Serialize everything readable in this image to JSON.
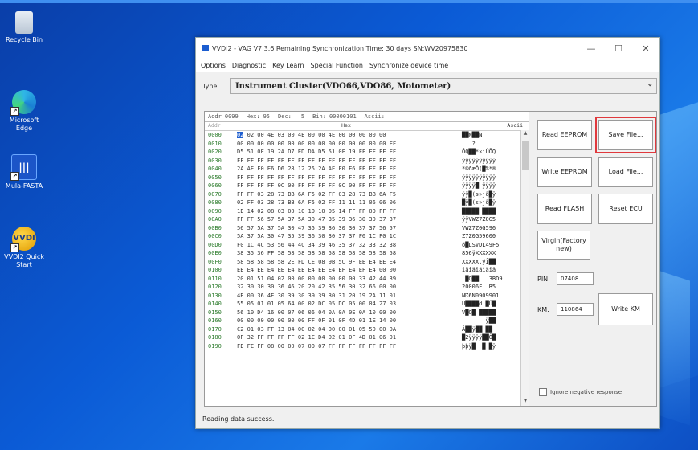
{
  "desktop": {
    "icons": [
      {
        "label": "Recycle Bin"
      },
      {
        "label": "Microsoft Edge"
      },
      {
        "label": "Mula-FASTA"
      },
      {
        "label": "VVDI2 Quick Start"
      }
    ]
  },
  "window": {
    "title": "VVDI2 - VAG V7.3.6    Remaining Synchronization Time: 30 days    SN:WV20975830",
    "menu": [
      "Options",
      "Diagnostic",
      "Key Learn",
      "Special Function",
      "Synchronize device time"
    ],
    "type_label": "Type",
    "type_value": "Instrument Cluster(VDO66,VDO86, Motometer)",
    "hex_header": {
      "addr_label": "Addr",
      "addr_value": "0099",
      "hex_label": "Hex:",
      "hex_value": "95",
      "dec_label": "Dec:",
      "dec_value": "5",
      "bin_label": "Bin:",
      "bin_value": "00000101",
      "ascii_label": "Ascii:"
    },
    "hex_columns": {
      "addr": "Addr",
      "hex": "Hex",
      "ascii": "Ascii"
    },
    "hex_rows": [
      {
        "addr": "0000",
        "sel": "02",
        "hex": " 02 00 4E 03 00 4E 00 00 4E 00 00 00 00 00",
        "ascii": "██N██N"
      },
      {
        "addr": "0010",
        "hex": "00 00 00 00 00 00 00 00 00 00 00 00 00 00 00 FF",
        "ascii": "   ?"
      },
      {
        "addr": "0020",
        "hex": "D5 51 0F 19 2A D7 ED DA D5 51 0F 19 FF FF FF FF",
        "ascii": "ÕQ██*×íÚÕQ"
      },
      {
        "addr": "0030",
        "hex": "FF FF FF FF FF FF FF FF FF FF FF FF FF FF FF FF",
        "ascii": "ÿÿÿÿÿÿÿÿÿÿ"
      },
      {
        "addr": "0040",
        "hex": "2A AE F0 E6 D6 28 12 25 2A AE F0 E6 FF FF FF FF",
        "ascii": "*®ðæÖ(█%*®"
      },
      {
        "addr": "0050",
        "hex": "FF FF FF FF FF FF FF FF FF FF FF FF FF FF FF FF",
        "ascii": "ÿÿÿÿÿÿÿÿÿÿ"
      },
      {
        "addr": "0060",
        "hex": "FF FF FF FF 0C 00 FF FF FF FF 0C 00 FF FF FF FF",
        "ascii": "ÿÿÿÿ█ ÿÿÿÿ"
      },
      {
        "addr": "0070",
        "hex": "FF FF 03 28 73 BB 6A F5 02 FF 03 28 73 BB 6A F5",
        "ascii": "ÿÿ█(s»jõ█ÿ"
      },
      {
        "addr": "0080",
        "hex": "02 FF 03 28 73 BB 6A F5 02 FF 11 11 11 06 06 06",
        "ascii": "█ÿ█(s»jõ█ÿ"
      },
      {
        "addr": "0090",
        "hex": "1E 14 02 08 03 00 10 10 10 05 14 FF FF 00 FF FF",
        "ascii": "█████ ████"
      },
      {
        "addr": "00A0",
        "hex": "FF FF 56 57 5A 37 5A 30 47 35 39 36 30 30 37 37",
        "ascii": "ÿÿVWZ7Z0G5"
      },
      {
        "addr": "00B0",
        "hex": "56 57 5A 37 5A 30 47 35 39 36 30 30 37 37 56 57",
        "ascii": "VWZ7Z0G596"
      },
      {
        "addr": "00C0",
        "hex": "5A 37 5A 30 47 35 39 36 30 30 37 37 F0 1C F0 1C",
        "ascii": "Z7Z0G59600"
      },
      {
        "addr": "00D0",
        "hex": "F0 1C 4C 53 56 44 4C 34 39 46 35 37 32 33 32 38",
        "ascii": "ð█LSVDL49F5"
      },
      {
        "addr": "00E0",
        "hex": "38 35 36 FF 58 58 58 58 58 58 58 58 58 58 58 58",
        "ascii": "856ÿXXXXXX"
      },
      {
        "addr": "00F0",
        "hex": "58 58 58 58 58 2E FD CE 08 9B 5C 9F EE E4 EE E4",
        "ascii": "XXXXX.ýÎ██"
      },
      {
        "addr": "0100",
        "hex": "EE E4 EE E4 EE E4 EE E4 EE E4 EF E4 EF E4 00 00",
        "ascii": "îäîäîäîäîä"
      },
      {
        "addr": "0110",
        "hex": "20 01 51 04 02 00 00 00 00 00 00 00 33 42 44 39",
        "ascii": " █Q██   3BD9"
      },
      {
        "addr": "0120",
        "hex": "32 30 30 30 36 46 20 20 42 35 56 30 32 66 00 00",
        "ascii": "20006F  B5"
      },
      {
        "addr": "0130",
        "hex": "4E 00 36 4E 30 39 30 39 39 30 31 20 19 2A 11 01",
        "ascii": "N☈6N0909901"
      },
      {
        "addr": "0140",
        "hex": "55 05 01 01 05 64 00 02 DC 05 DC 05 00 04 27 03",
        "ascii": "U████d █Ü█"
      },
      {
        "addr": "0150",
        "hex": "56 10 D4 16 00 07 06 06 04 0A 0A 0E 0A 10 00 00",
        "ascii": "V█Ô█ █████"
      },
      {
        "addr": "0160",
        "hex": "00 00 00 00 00 00 00 FF 0F 01 0F 4D 01 1E 14 00",
        "ascii": "       ÿ██"
      },
      {
        "addr": "0170",
        "hex": "C2 01 03 FF 13 04 00 02 04 00 00 01 05 50 00 0A",
        "ascii": "Â██ÿ██ ██"
      },
      {
        "addr": "0180",
        "hex": "0F 32 FF FF FF FF 02 1E D4 02 01 0F 4D 01 06 01",
        "ascii": "█2ÿÿÿÿ██Ô█"
      },
      {
        "addr": "0190",
        "hex": "FE FE FF 08 00 00 07 00 07 FF FF FF FF FF FF FF",
        "ascii": "þþÿ█  █ █ÿ"
      }
    ],
    "buttons": {
      "read_eeprom": "Read EEPROM",
      "save_file": "Save File...",
      "write_eeprom": "Write EEPROM",
      "load_file": "Load File...",
      "read_flash": "Read FLASH",
      "reset_ecu": "Reset ECU",
      "virgin": "Virgin(Factory new)",
      "write_km": "Write KM"
    },
    "pin_label": "PIN:",
    "pin_value": "07408",
    "km_label": "KM:",
    "km_value": "110864",
    "ignore_label": "Ignore negative response",
    "status": "Reading data success."
  }
}
